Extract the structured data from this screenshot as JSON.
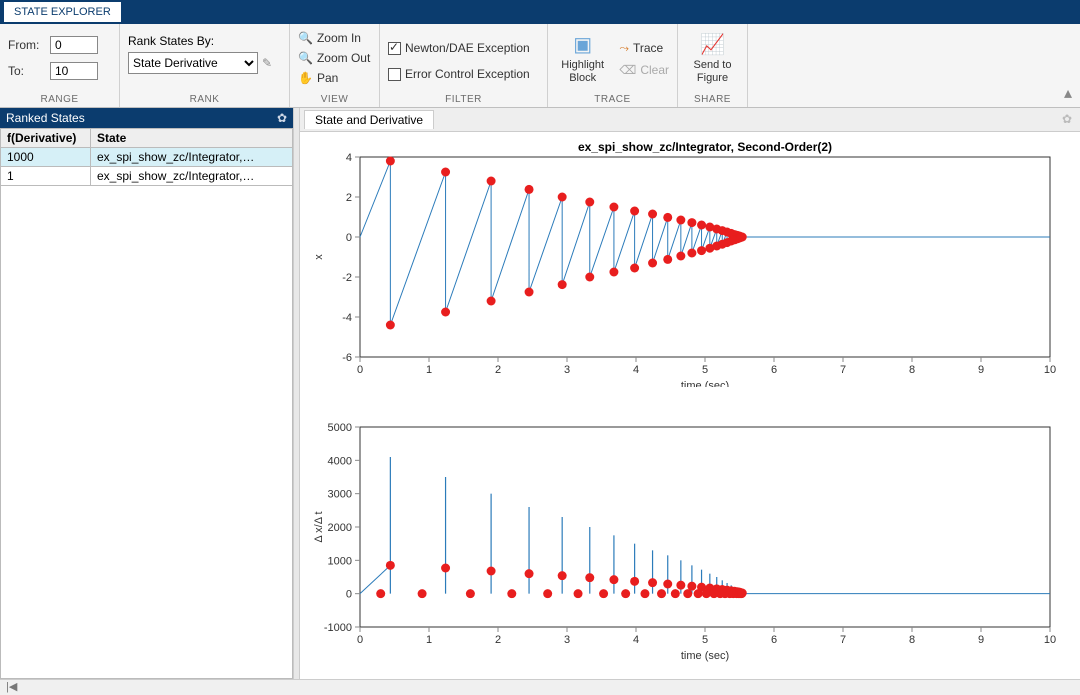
{
  "titleTab": "STATE EXPLORER",
  "ribbon": {
    "range": {
      "fromLabel": "From:",
      "toLabel": "To:",
      "from": "0",
      "to": "10",
      "group": "RANGE"
    },
    "rank": {
      "label": "Rank States By:",
      "value": "State Derivative",
      "group": "RANK"
    },
    "view": {
      "zoomIn": "Zoom In",
      "zoomOut": "Zoom Out",
      "pan": "Pan",
      "group": "VIEW"
    },
    "filter": {
      "newton": "Newton/DAE Exception",
      "newtonChecked": true,
      "error": "Error Control Exception",
      "errorChecked": false,
      "group": "FILTER"
    },
    "trace": {
      "highlight": "Highlight Block",
      "trace": "Trace",
      "clear": "Clear",
      "group": "TRACE"
    },
    "share": {
      "send": "Send to Figure",
      "group": "SHARE"
    }
  },
  "rankedPanel": {
    "title": "Ranked States",
    "colDeriv": "f(Derivative)",
    "colState": "State",
    "rows": [
      {
        "deriv": "1000",
        "state": "ex_spi_show_zc/Integrator,…",
        "selected": true
      },
      {
        "deriv": "1",
        "state": "ex_spi_show_zc/Integrator,…",
        "selected": false
      }
    ]
  },
  "plotTab": "State and Derivative",
  "chart_data": [
    {
      "type": "line+scatter",
      "title": "ex_spi_show_zc/Integrator,  Second-Order(2)",
      "xlabel": "time (sec)",
      "ylabel": "x",
      "xlim": [
        0,
        10
      ],
      "ylim": [
        -6,
        4
      ],
      "xticks": [
        0,
        1,
        2,
        3,
        4,
        5,
        6,
        7,
        8,
        9,
        10
      ],
      "yticks": [
        -6,
        -4,
        -2,
        0,
        2,
        4
      ],
      "points": [
        [
          0.0,
          0.0
        ],
        [
          0.44,
          3.8
        ],
        [
          0.44,
          -4.4
        ],
        [
          1.24,
          3.25
        ],
        [
          1.24,
          -3.75
        ],
        [
          1.9,
          2.8
        ],
        [
          1.9,
          -3.2
        ],
        [
          2.45,
          2.38
        ],
        [
          2.45,
          -2.75
        ],
        [
          2.93,
          2.0
        ],
        [
          2.93,
          -2.38
        ],
        [
          3.33,
          1.75
        ],
        [
          3.33,
          -2.0
        ],
        [
          3.68,
          1.5
        ],
        [
          3.68,
          -1.75
        ],
        [
          3.98,
          1.3
        ],
        [
          3.98,
          -1.55
        ],
        [
          4.24,
          1.15
        ],
        [
          4.24,
          -1.3
        ],
        [
          4.46,
          0.98
        ],
        [
          4.46,
          -1.12
        ],
        [
          4.65,
          0.85
        ],
        [
          4.65,
          -0.95
        ],
        [
          4.81,
          0.72
        ],
        [
          4.81,
          -0.8
        ],
        [
          4.95,
          0.6
        ],
        [
          4.95,
          -0.68
        ],
        [
          5.07,
          0.5
        ],
        [
          5.07,
          -0.56
        ],
        [
          5.17,
          0.4
        ],
        [
          5.17,
          -0.45
        ],
        [
          5.25,
          0.32
        ],
        [
          5.25,
          -0.36
        ],
        [
          5.32,
          0.25
        ],
        [
          5.32,
          -0.28
        ],
        [
          5.38,
          0.18
        ],
        [
          5.38,
          -0.2
        ],
        [
          5.43,
          0.12
        ],
        [
          5.43,
          -0.14
        ],
        [
          5.47,
          0.08
        ],
        [
          5.47,
          -0.09
        ],
        [
          5.5,
          0.05
        ],
        [
          5.5,
          -0.05
        ],
        [
          5.52,
          0.02
        ],
        [
          5.52,
          -0.02
        ],
        [
          5.54,
          0.0
        ],
        [
          10.0,
          0.0
        ]
      ],
      "line_tail": [
        [
          5.54,
          0
        ],
        [
          10,
          0
        ]
      ]
    },
    {
      "type": "line+scatter",
      "xlabel": "time (sec)",
      "ylabel": "Δ x/Δ t",
      "xlim": [
        0,
        10
      ],
      "ylim": [
        -1000,
        5000
      ],
      "xticks": [
        0,
        1,
        2,
        3,
        4,
        5,
        6,
        7,
        8,
        9,
        10
      ],
      "yticks": [
        -1000,
        0,
        1000,
        2000,
        3000,
        4000,
        5000
      ],
      "stems": [
        [
          0.44,
          4100
        ],
        [
          1.24,
          3500
        ],
        [
          1.9,
          3000
        ],
        [
          2.45,
          2600
        ],
        [
          2.93,
          2300
        ],
        [
          3.33,
          2000
        ],
        [
          3.68,
          1750
        ],
        [
          3.98,
          1500
        ],
        [
          4.24,
          1300
        ],
        [
          4.46,
          1150
        ],
        [
          4.65,
          1000
        ],
        [
          4.81,
          850
        ],
        [
          4.95,
          720
        ],
        [
          5.07,
          600
        ],
        [
          5.17,
          500
        ],
        [
          5.25,
          400
        ],
        [
          5.32,
          320
        ],
        [
          5.38,
          250
        ],
        [
          5.43,
          190
        ],
        [
          5.47,
          140
        ],
        [
          5.5,
          100
        ],
        [
          5.52,
          60
        ],
        [
          5.54,
          30
        ]
      ],
      "dots": [
        [
          0.3,
          0
        ],
        [
          0.44,
          850
        ],
        [
          0.9,
          0
        ],
        [
          1.24,
          770
        ],
        [
          1.6,
          0
        ],
        [
          1.9,
          680
        ],
        [
          2.2,
          0
        ],
        [
          2.45,
          600
        ],
        [
          2.72,
          0
        ],
        [
          2.93,
          540
        ],
        [
          3.16,
          0
        ],
        [
          3.33,
          480
        ],
        [
          3.53,
          0
        ],
        [
          3.68,
          420
        ],
        [
          3.85,
          0
        ],
        [
          3.98,
          370
        ],
        [
          4.13,
          0
        ],
        [
          4.24,
          330
        ],
        [
          4.37,
          0
        ],
        [
          4.46,
          290
        ],
        [
          4.57,
          0
        ],
        [
          4.65,
          255
        ],
        [
          4.75,
          0
        ],
        [
          4.81,
          225
        ],
        [
          4.9,
          0
        ],
        [
          4.95,
          195
        ],
        [
          5.02,
          0
        ],
        [
          5.07,
          170
        ],
        [
          5.13,
          0
        ],
        [
          5.17,
          145
        ],
        [
          5.22,
          0
        ],
        [
          5.25,
          125
        ],
        [
          5.29,
          0
        ],
        [
          5.32,
          105
        ],
        [
          5.36,
          0
        ],
        [
          5.38,
          88
        ],
        [
          5.41,
          0
        ],
        [
          5.43,
          72
        ],
        [
          5.46,
          0
        ],
        [
          5.47,
          58
        ],
        [
          5.49,
          0
        ],
        [
          5.5,
          45
        ],
        [
          5.51,
          0
        ],
        [
          5.52,
          32
        ],
        [
          5.53,
          0
        ],
        [
          5.54,
          20
        ]
      ],
      "line_tail": [
        [
          5.54,
          0
        ],
        [
          10,
          0
        ]
      ]
    }
  ],
  "status": "|◀"
}
